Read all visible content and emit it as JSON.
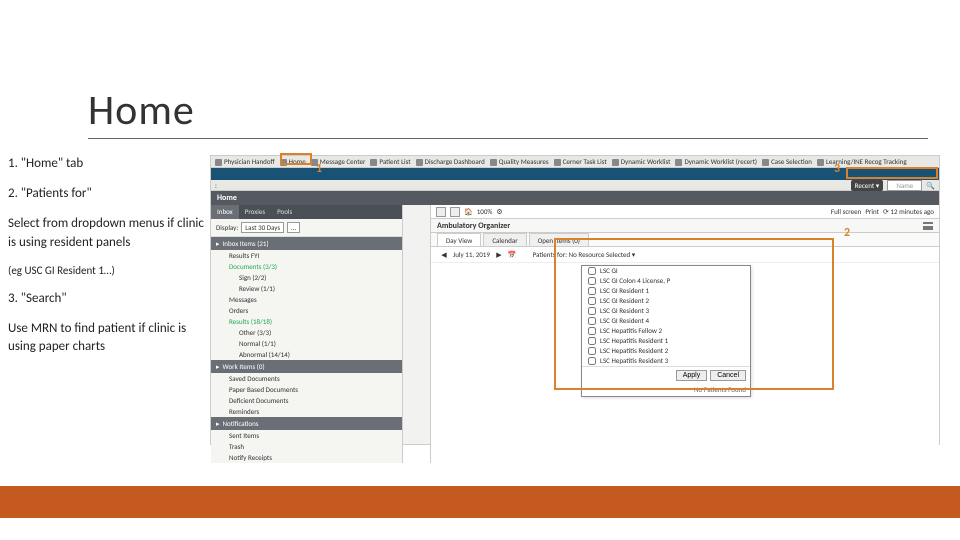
{
  "slide": {
    "title": "Home"
  },
  "instructions": {
    "step1": "1. \"Home\" tab",
    "step2": "2. \"Patients for\"",
    "step2b": "Select from dropdown menus if clinic is using resident panels",
    "step2c": "(eg USC GI Resident 1…)",
    "step3": "3. \"Search\"",
    "step3b": "Use MRN to find patient if clinic is using paper charts"
  },
  "toptabs": {
    "t1": "Physician Handoff",
    "t2": "Home",
    "t3": "Message Center",
    "t4": "Patient List",
    "t5": "Discharge Dashboard",
    "t6": "Quality Measures",
    "t7": "Cerner Task List",
    "t8": "Dynamic Worklist",
    "t9": "Dynamic Worklist (recert)",
    "t10": "Case Selection",
    "t11": "Learning/INE Recog Tracking"
  },
  "toolbar2": {
    "left": ":",
    "recent": "Recent ▾",
    "search": "Name",
    "magnify": "🔍"
  },
  "home": {
    "label": "Home"
  },
  "leftpanel": {
    "tabs": {
      "inbox": "Inbox",
      "proxies": "Proxies",
      "pools": "Pools"
    },
    "display_label": "Display:",
    "display_value": "Last 30 Days",
    "inbox_items": "Inbox Items (21)",
    "results_fyi": "Results FYI",
    "documents": "Documents (3/3)",
    "sign": "Sign (2/2)",
    "review": "Review (1/1)",
    "messages": "Messages",
    "orders": "Orders",
    "results": "Results (18/18)",
    "other": "Other (3/3)",
    "normal": "Normal (1/1)",
    "abnormal": "Abnormal (14/14)",
    "work_items": "Work Items (0)",
    "saved_docs": "Saved Documents",
    "paper_docs": "Paper Based Documents",
    "deficient": "Deficient Documents",
    "reminders": "Reminders",
    "notifications": "Notifications",
    "sent": "Sent Items",
    "trash": "Trash",
    "notify": "Notify Receipts"
  },
  "rightpanel": {
    "zoom": "100%",
    "head": "Ambulatory Organizer",
    "tab_day": "Day View",
    "tab_cal": "Calendar",
    "tab_open": "Open Items (0)",
    "date": "July 11, 2019",
    "selector": "Patients for: No Resource Selected ▾"
  },
  "dropdown": {
    "items": [
      "LSC GI",
      "LSC GI Colon 4 License, P",
      "LSC GI Resident 1",
      "LSC GI Resident 2",
      "LSC GI Resident 3",
      "LSC GI Resident 4",
      "LSC Hepatitis Fellow 2",
      "LSC Hepatitis Resident 1",
      "LSC Hepatitis Resident 2",
      "LSC Hepatitis Resident 3"
    ],
    "apply": "Apply",
    "cancel": "Cancel",
    "footer": "No Patients Found"
  },
  "statusbar": {
    "fullscreen": "Full screen",
    "print": "Print",
    "ago": "12 minutes ago"
  },
  "callouts": {
    "c1": "1",
    "c2": "2",
    "c3": "3"
  }
}
